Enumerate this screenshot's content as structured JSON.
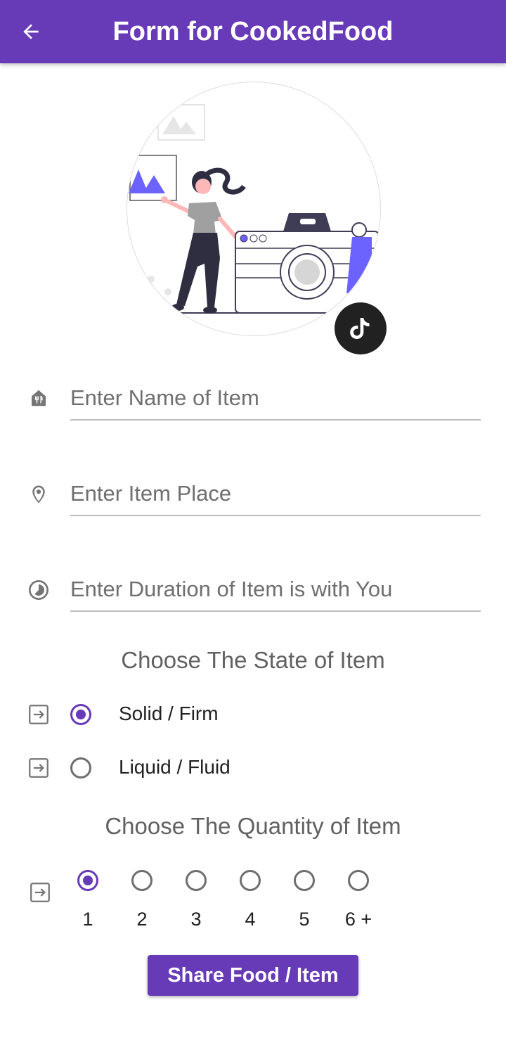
{
  "appbar": {
    "title": "Form for CookedFood",
    "back_icon": "arrow-back-icon",
    "color": "#673ab7"
  },
  "photo": {
    "illustration": "person-with-camera-illustration",
    "fab_icon": "tiktok-icon"
  },
  "fields": [
    {
      "icon": "restaurant-icon",
      "placeholder": "Enter Name of Item",
      "value": ""
    },
    {
      "icon": "place-icon",
      "placeholder": "Enter Item Place",
      "value": ""
    },
    {
      "icon": "timelapse-icon",
      "placeholder": "Enter Duration of Item is with You",
      "value": ""
    }
  ],
  "state_section": {
    "title": "Choose The State of Item",
    "row_icon": "input-arrow-icon",
    "options": [
      {
        "label": "Solid / Firm",
        "selected": true
      },
      {
        "label": "Liquid / Fluid",
        "selected": false
      }
    ]
  },
  "quantity_section": {
    "title": "Choose The Quantity of Item",
    "row_icon": "input-arrow-icon",
    "options": [
      {
        "label": "1",
        "selected": true
      },
      {
        "label": "2",
        "selected": false
      },
      {
        "label": "3",
        "selected": false
      },
      {
        "label": "4",
        "selected": false
      },
      {
        "label": "5",
        "selected": false
      },
      {
        "label": "6 +",
        "selected": false
      }
    ]
  },
  "submit": {
    "label": "Share Food / Item"
  }
}
